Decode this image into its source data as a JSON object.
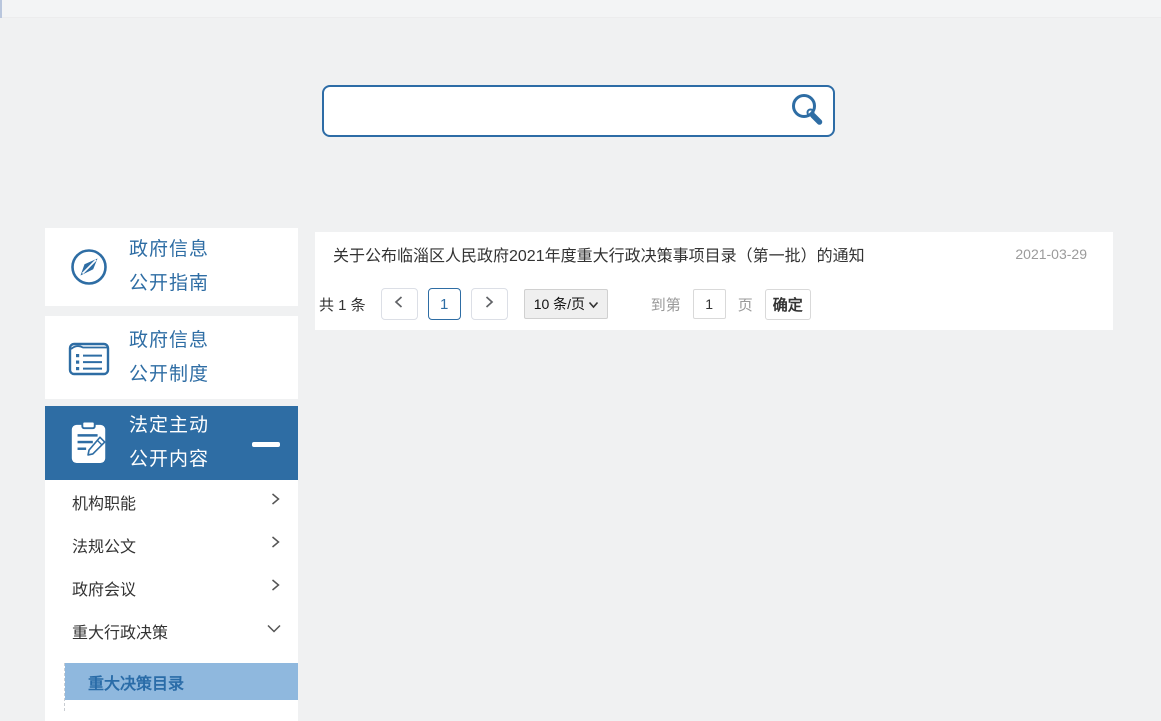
{
  "page": {
    "accent_blue": "#2e6da4",
    "highlight_blue": "#8fb8de",
    "background": "#f0f1f2"
  },
  "icons": {
    "search": "magnifier",
    "guide": "compass",
    "system": "ledger-document",
    "active_section": "clipboard-pencil",
    "collapse": "minus",
    "collapsed_row": "chevron-right",
    "expanded_row": "chevron-down",
    "select_caret": "chevron-down"
  },
  "search": {
    "value": "",
    "placeholder": ""
  },
  "sidebar": {
    "items": [
      {
        "line1": "政府信息",
        "line2": "公开指南",
        "icon": "compass-icon",
        "active": false
      },
      {
        "line1": "政府信息",
        "line2": "公开制度",
        "icon": "document-icon",
        "active": false
      },
      {
        "line1": "法定主动",
        "line2": "公开内容",
        "icon": "clipboard-pencil-icon",
        "active": true,
        "toggle": "minus"
      }
    ],
    "submenu": [
      {
        "label": "机构职能",
        "state": "collapsed"
      },
      {
        "label": "法规公文",
        "state": "collapsed"
      },
      {
        "label": "政府会议",
        "state": "collapsed"
      },
      {
        "label": "重大行政决策",
        "state": "expanded"
      }
    ],
    "subsubmenu": [
      {
        "label": "重大决策目录",
        "selected": true
      }
    ]
  },
  "content": {
    "list": [
      {
        "title": "关于公布临淄区人民政府2021年度重大行政决策事项目录（第一批）的通知",
        "date": "2021-03-29"
      }
    ],
    "pagination": {
      "total": "共 1 条",
      "current_page": "1",
      "page_size": "10 条/页",
      "goto_prefix": "到第",
      "goto_value": "1",
      "goto_suffix": "页",
      "confirm": "确定"
    }
  }
}
